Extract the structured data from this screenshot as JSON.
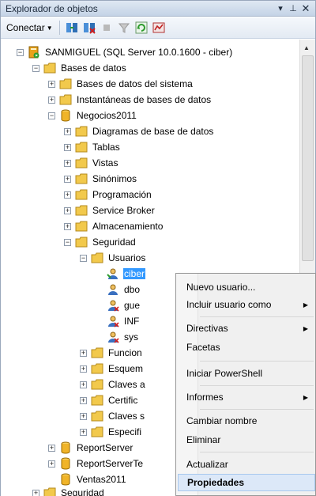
{
  "window": {
    "title": "Explorador de objetos",
    "pin_glyph": "▾",
    "autohide_glyph": "⊥",
    "close_glyph": "✕"
  },
  "toolbar": {
    "connect_label": "Conectar",
    "buttons": [
      "connect-icon",
      "disconnect-icon",
      "stop-icon",
      "filter-icon",
      "refresh-icon",
      "activity-icon"
    ]
  },
  "tree": {
    "server": "SANMIGUEL (SQL Server 10.0.1600 - ciber)",
    "databases": "Bases de datos",
    "system_databases": "Bases de datos del sistema",
    "snapshots": "Instantáneas de bases de datos",
    "negocios": "Negocios2011",
    "diagrams": "Diagramas de base de datos",
    "tables": "Tablas",
    "views": "Vistas",
    "synonyms": "Sinónimos",
    "programmability": "Programación",
    "service_broker": "Service Broker",
    "storage": "Almacenamiento",
    "security": "Seguridad",
    "users": "Usuarios",
    "user_ciber": "ciber",
    "user_dbo": "dbo",
    "user_guest": "gue",
    "user_info": "INF",
    "user_sys": "sys",
    "roles": "Funcion",
    "schemas": "Esquem",
    "asym_keys": "Claves a",
    "certificates": "Certific",
    "sym_keys": "Claves s",
    "audit_specs": "Especifi",
    "report_server": "ReportServer",
    "report_server_temp": "ReportServerTe",
    "ventas": "Ventas2011",
    "server_security": "Seguridad"
  },
  "context_menu": {
    "new_user": "Nuevo usuario...",
    "script_as": "Incluir usuario como",
    "policies": "Directivas",
    "facets": "Facetas",
    "powershell": "Iniciar PowerShell",
    "reports": "Informes",
    "rename": "Cambiar nombre",
    "delete": "Eliminar",
    "refresh": "Actualizar",
    "properties": "Propiedades",
    "submenu_arrow": "▶"
  },
  "colors": {
    "selection": "#3399ff",
    "menu_highlight": "#dce8f8",
    "folder": "#f2c94c",
    "database": "#f0b429"
  }
}
